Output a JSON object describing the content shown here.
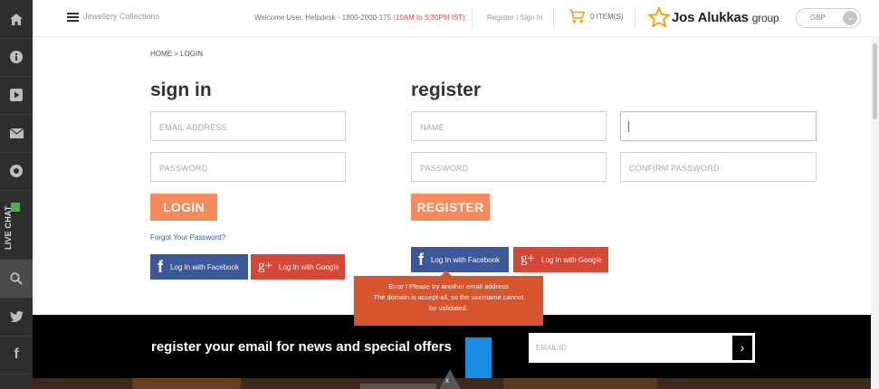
{
  "side_rail": {
    "icons": [
      "home-icon",
      "info-icon",
      "play-icon",
      "mail-icon",
      "chat-icon",
      "search-icon",
      "twitter-icon",
      "facebook-icon"
    ],
    "live_chat_label": "LIVE CHAT"
  },
  "header": {
    "menu_label": "Jewellery Collections",
    "welcome_text": "Welcome User, Helpdesk - 1800-2000-175 ",
    "hours": "(10AM to 5:30PM IST)",
    "register_link": "Register",
    "separator": "I",
    "signin_link": "Sign In",
    "cart_label": "0 ITEM(S)",
    "logo_name": "Jos Alukkas",
    "logo_suffix": "group",
    "currency": "GBP"
  },
  "breadcrumb": "HOME > LOGIN",
  "signin": {
    "title": "sign in",
    "email_placeholder": "EMAIL ADDRESS",
    "password_placeholder": "PASSWORD",
    "login_button": "LOGIN",
    "forgot_link": "Forgot Your Password?",
    "facebook_button": "Log In with Facebook",
    "google_button": "Log In with Google"
  },
  "register": {
    "title": "register",
    "name_placeholder": "NAME",
    "email_value": "",
    "password_placeholder": "PASSWORD",
    "confirm_placeholder": "CONFIRM PASSWORD",
    "register_button": "REGISTER",
    "facebook_button": "Log In with Facebook",
    "google_button": "Log In with Google"
  },
  "error_tooltip": {
    "line1": "Error ! Please try another email address",
    "line2": "The domain is accept-all, so the username cannot",
    "line3": "be validated."
  },
  "newsletter": {
    "text": "register your email for news and special offers",
    "placeholder": "EMAIL ID",
    "submit_glyph": "›"
  },
  "close_label": "x",
  "colors": {
    "accent_orange": "#f58a5d",
    "facebook_blue": "#3b5998",
    "google_red": "#d34836",
    "error_bg": "#d6552e",
    "rail_bg": "#2e2e2e"
  }
}
